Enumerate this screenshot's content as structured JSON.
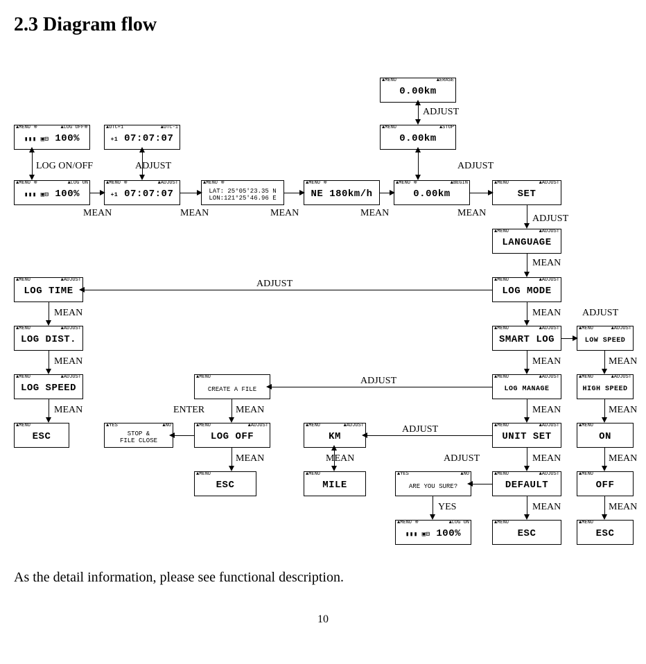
{
  "heading": "2.3  Diagram flow",
  "bodytext": "As the detail information, please see functional description.",
  "pagenum": "10",
  "labels": {
    "log_onoff": "LOG ON/OFF",
    "adjust": "ADJUST",
    "mean": "MEAN",
    "enter": "ENTER",
    "yes": "YES"
  },
  "screens": {
    "menu": "▲MENU",
    "menu_ss": "▲MENU ※",
    "erase": "▲ERASE",
    "stop": "▲STOP",
    "begin": "▲BEGIN",
    "adjust": "▲ADJUST",
    "log_on": "▲LOG ON",
    "utc_plus": "▲UTC+1",
    "utc_minus": "▲UTC-1",
    "yes": "▲YES",
    "no": "▲NO",
    "km_000": "0.00km",
    "pct_100": "100%",
    "time_070707": "07:07:07",
    "latlon": "LAT: 25°05'23.35 N\nLON:121°25'46.96 E",
    "ne180": "NE 180km/h",
    "set": "SET",
    "language": "LANGUAGE",
    "log_mode": "LOG MODE",
    "log_time": "LOG TIME",
    "log_dist": "LOG DIST.",
    "log_speed": "LOG SPEED",
    "smart_log": "SMART LOG",
    "low_speed": "LOW SPEED",
    "log_manage": "LOG MANAGE",
    "high_speed": "HIGH SPEED",
    "create_file": "CREATE A FILE",
    "log_off_body": "LOG OFF",
    "stop_file_close": "STOP &\nFILE CLOSE",
    "esc": "ESC",
    "km": "KM",
    "mile": "MILE",
    "unit_set": "UNIT SET",
    "on": "ON",
    "default": "DEFAULT",
    "off": "OFF",
    "are_you_sure": "ARE YOU SURE?",
    "log_off_tag": "▲LOG OFF※",
    "bars_icon": "▮▮▮ ▣⊟"
  }
}
